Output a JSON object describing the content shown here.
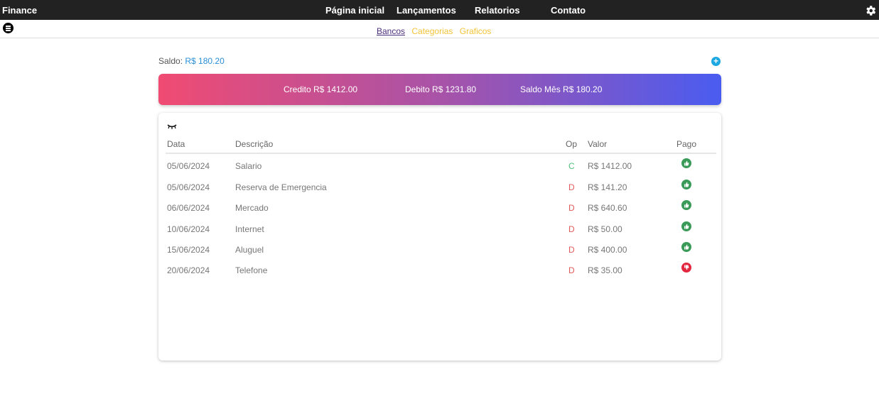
{
  "app": {
    "brand": "Finance"
  },
  "nav": {
    "items": [
      "Página inicial",
      "Lançamentos",
      "Relatorios",
      "Contato"
    ]
  },
  "subnav": {
    "items": [
      {
        "label": "Bancos",
        "active": true
      },
      {
        "label": "Categorias",
        "active": false
      },
      {
        "label": "Graficos",
        "active": false
      }
    ]
  },
  "summary": {
    "saldo_label": "Saldo:",
    "saldo_value": "R$ 180.20",
    "credito": "Credito R$ 1412.00",
    "debito": "Debito R$ 1231.80",
    "saldo_mes": "Saldo Mês R$ 180.20"
  },
  "table": {
    "headers": {
      "data": "Data",
      "descricao": "Descrição",
      "op": "Op",
      "valor": "Valor",
      "pago": "Pago"
    },
    "rows": [
      {
        "data": "05/06/2024",
        "descricao": "Salario",
        "op": "C",
        "valor": "R$ 1412.00",
        "pago": true
      },
      {
        "data": "05/06/2024",
        "descricao": "Reserva de Emergencia",
        "op": "D",
        "valor": "R$ 141.20",
        "pago": true
      },
      {
        "data": "06/06/2024",
        "descricao": "Mercado",
        "op": "D",
        "valor": "R$ 640.60",
        "pago": true
      },
      {
        "data": "10/06/2024",
        "descricao": "Internet",
        "op": "D",
        "valor": "R$ 50.00",
        "pago": true
      },
      {
        "data": "15/06/2024",
        "descricao": "Aluguel",
        "op": "D",
        "valor": "R$ 400.00",
        "pago": true
      },
      {
        "data": "20/06/2024",
        "descricao": "Telefone",
        "op": "D",
        "valor": "R$ 35.00",
        "pago": false
      }
    ]
  },
  "icons": {
    "settings": "gear-icon",
    "menu": "menu-icon",
    "add": "plus-icon",
    "visibility": "eye-closed-icon",
    "paid": "thumbs-up-icon",
    "unpaid": "thumbs-down-icon"
  },
  "colors": {
    "topbar": "#222222",
    "banner_start": "#f04b72",
    "banner_mid": "#a853a8",
    "banner_end": "#4a5cf0",
    "paid": "#3a9a58",
    "unpaid": "#e2283f",
    "credit_op": "#52c17c",
    "debit_op": "#e35a5a",
    "subnav_active": "#4b2f7a",
    "subnav_other": "#f2c438"
  }
}
